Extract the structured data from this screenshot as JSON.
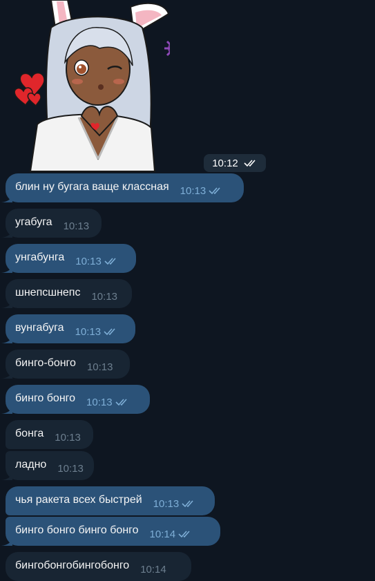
{
  "sticker": {
    "time": "10:12"
  },
  "messages": [
    {
      "text": "блин ну бугага ваще классная",
      "time": "10:13",
      "dir": "out"
    },
    {
      "text": "угабуга",
      "time": "10:13",
      "dir": "in"
    },
    {
      "text": "унгабунга",
      "time": "10:13",
      "dir": "out"
    },
    {
      "text": "шнепсшнепс",
      "time": "10:13",
      "dir": "in"
    },
    {
      "text": "вунгабуга",
      "time": "10:13",
      "dir": "out"
    },
    {
      "text": "бинго-бонго",
      "time": "10:13",
      "dir": "in"
    },
    {
      "text": "бинго бонго",
      "time": "10:13",
      "dir": "out"
    },
    {
      "text": "бонга",
      "time": "10:13",
      "dir": "in"
    },
    {
      "text": "ладно",
      "time": "10:13",
      "dir": "in"
    },
    {
      "text": "чья ракета всех быстрей",
      "time": "10:13",
      "dir": "out"
    },
    {
      "text": "бинго бонго бинго бонго",
      "time": "10:14",
      "dir": "out"
    },
    {
      "text": "бингобонгобингобонго",
      "time": "10:14",
      "dir": "in"
    }
  ],
  "colors": {
    "background": "#0e1621",
    "outgoing_bubble": "#2b5278",
    "incoming_bubble": "#182533",
    "read_checks": "#7eaed6"
  }
}
